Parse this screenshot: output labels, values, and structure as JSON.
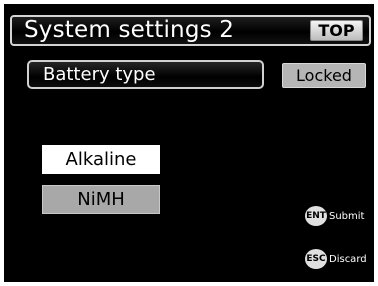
{
  "header": {
    "title": "System settings 2",
    "top_button_label": "TOP"
  },
  "setting": {
    "label": "Battery type",
    "status": "Locked"
  },
  "options": [
    {
      "label": "Alkaline",
      "selected": true
    },
    {
      "label": "NiMH",
      "selected": false
    }
  ],
  "hints": {
    "submit": {
      "key": "ENT",
      "label": "Submit"
    },
    "discard": {
      "key": "ESC",
      "label": "Discard"
    }
  },
  "colors": {
    "background": "#000000",
    "selected_option": "#ffffff",
    "unselected_option": "#a8a8a8",
    "locked_badge": "#b5b5b5"
  }
}
